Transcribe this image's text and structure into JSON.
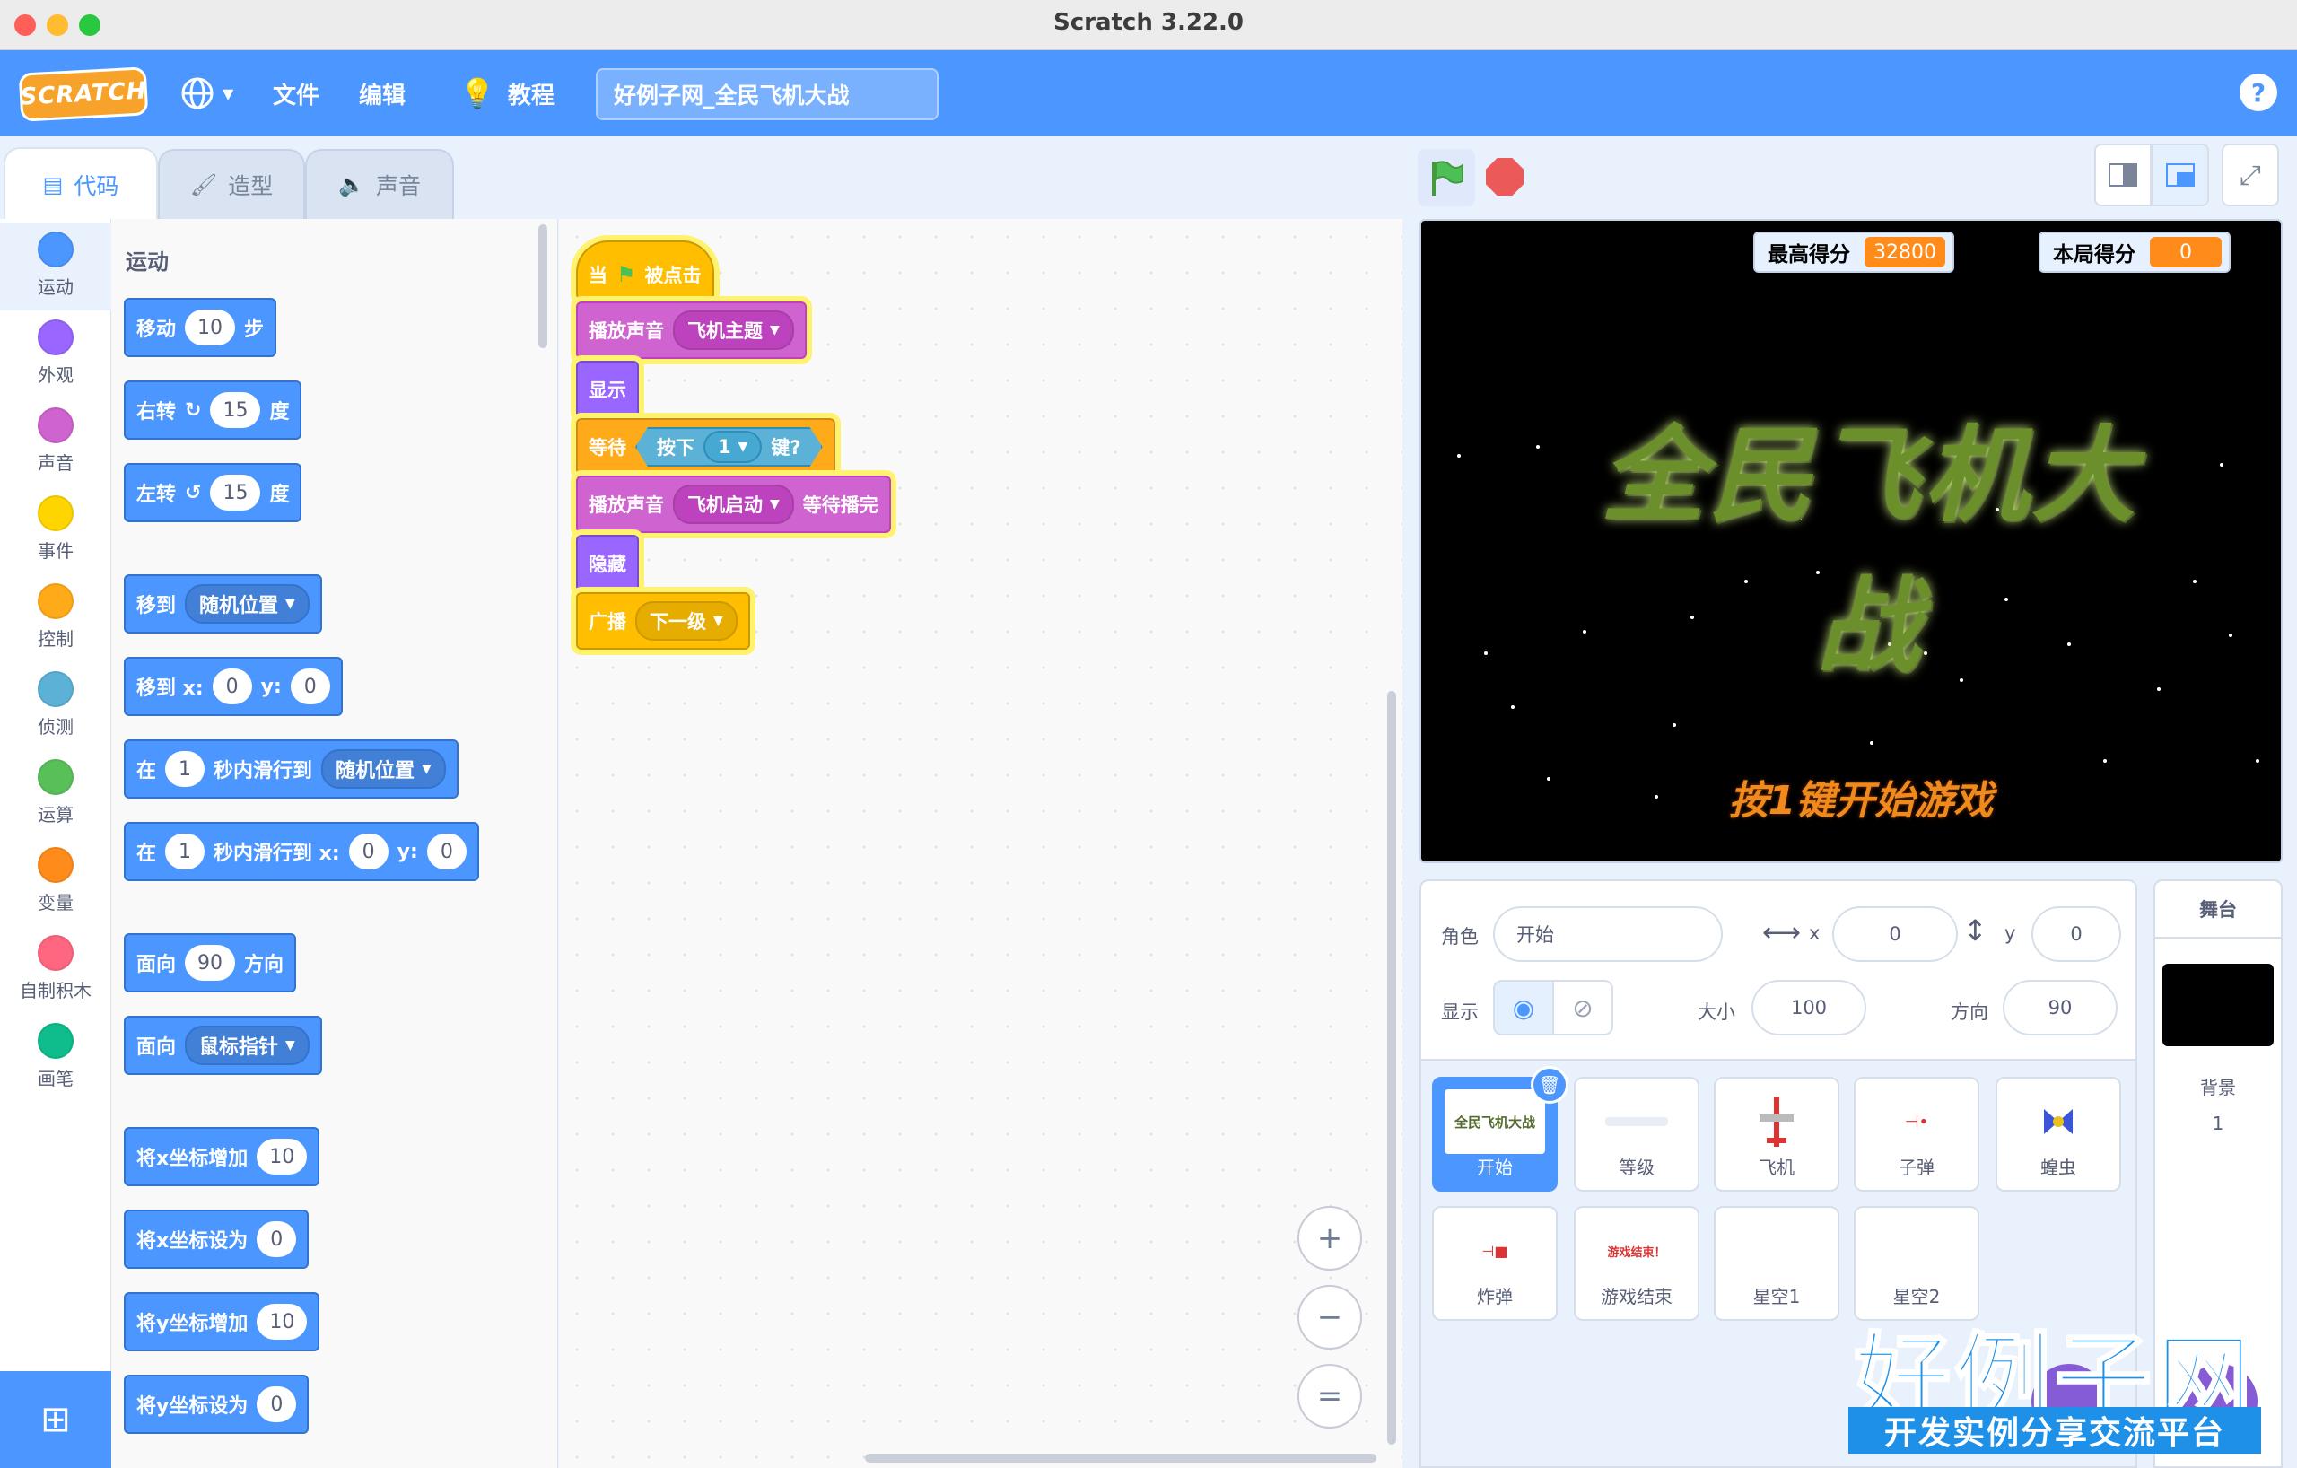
{
  "window": {
    "title": "Scratch 3.22.0"
  },
  "menubar": {
    "logo": "SCRATCH",
    "file": "文件",
    "edit": "编辑",
    "tutorials": "教程",
    "project_title": "好例子网_全民飞机大战",
    "help": "?"
  },
  "tabs": {
    "code": "代码",
    "costumes": "造型",
    "sounds": "声音"
  },
  "categories": [
    {
      "label": "运动",
      "color": "#4c97ff"
    },
    {
      "label": "外观",
      "color": "#9966ff"
    },
    {
      "label": "声音",
      "color": "#cf63cf"
    },
    {
      "label": "事件",
      "color": "#ffd500"
    },
    {
      "label": "控制",
      "color": "#ffab19"
    },
    {
      "label": "侦测",
      "color": "#5cb1d6"
    },
    {
      "label": "运算",
      "color": "#59c059"
    },
    {
      "label": "变量",
      "color": "#ff8c1a"
    },
    {
      "label": "自制积木",
      "color": "#ff6680"
    },
    {
      "label": "画笔",
      "color": "#0fbd8c"
    }
  ],
  "palette": {
    "section_title": "运动",
    "move": {
      "a": "移动",
      "val": "10",
      "b": "步"
    },
    "turn_right": {
      "a": "右转",
      "val": "15",
      "b": "度"
    },
    "turn_left": {
      "a": "左转",
      "val": "15",
      "b": "度"
    },
    "goto": {
      "a": "移到",
      "menu": "随机位置"
    },
    "goto_xy": {
      "a": "移到 x:",
      "x": "0",
      "b": "y:",
      "y": "0"
    },
    "glide": {
      "a": "在",
      "val": "1",
      "b": "秒内滑行到",
      "menu": "随机位置"
    },
    "glide_xy": {
      "a": "在",
      "val": "1",
      "b": "秒内滑行到 x:",
      "x": "0",
      "c": "y:",
      "y": "0"
    },
    "point_dir": {
      "a": "面向",
      "val": "90",
      "b": "方向"
    },
    "point_towards": {
      "a": "面向",
      "menu": "鼠标指针"
    },
    "change_x": {
      "a": "将x坐标增加",
      "val": "10"
    },
    "set_x": {
      "a": "将x坐标设为",
      "val": "0"
    },
    "change_y": {
      "a": "将y坐标增加",
      "val": "10"
    },
    "set_y": {
      "a": "将y坐标设为",
      "val": "0"
    }
  },
  "script": {
    "hat": {
      "a": "当",
      "b": "被点击"
    },
    "play1": {
      "a": "播放声音",
      "menu": "飞机主题"
    },
    "show": "显示",
    "wait": {
      "a": "等待",
      "b": "按下",
      "key": "1",
      "c": "键?"
    },
    "play2": {
      "a": "播放声音",
      "menu": "飞机启动",
      "b": "等待播完"
    },
    "hide": "隐藏",
    "broadcast": {
      "a": "广播",
      "menu": "下一级"
    }
  },
  "zoom": {
    "in": "+",
    "out": "−",
    "reset": "="
  },
  "stage": {
    "monitors": [
      {
        "label": "最高得分",
        "value": "32800"
      },
      {
        "label": "本局得分",
        "value": "0"
      }
    ],
    "title": "全民飞机大战",
    "subtitle": "按1键开始游戏"
  },
  "sprite_info": {
    "sprite_label": "角色",
    "sprite_name": "开始",
    "x_label": "x",
    "x": "0",
    "y_label": "y",
    "y": "0",
    "show_label": "显示",
    "size_label": "大小",
    "size": "100",
    "direction_label": "方向",
    "direction": "90"
  },
  "sprites": [
    {
      "name": "开始",
      "selected": true
    },
    {
      "name": "等级"
    },
    {
      "name": "飞机"
    },
    {
      "name": "子弹"
    },
    {
      "name": "蝗虫"
    },
    {
      "name": "炸弹"
    },
    {
      "name": "游戏结束"
    },
    {
      "name": "星空1"
    },
    {
      "name": "星空2"
    }
  ],
  "sprite_thumbs": {
    "start_text": "全民飞机大战",
    "gameover_text": "游戏结束！"
  },
  "stage_panel": {
    "title": "舞台",
    "backdrop_label": "背景",
    "backdrop_count": "1"
  },
  "watermark": {
    "title": "好例子网",
    "subtitle": "开发实例分享交流平台"
  }
}
